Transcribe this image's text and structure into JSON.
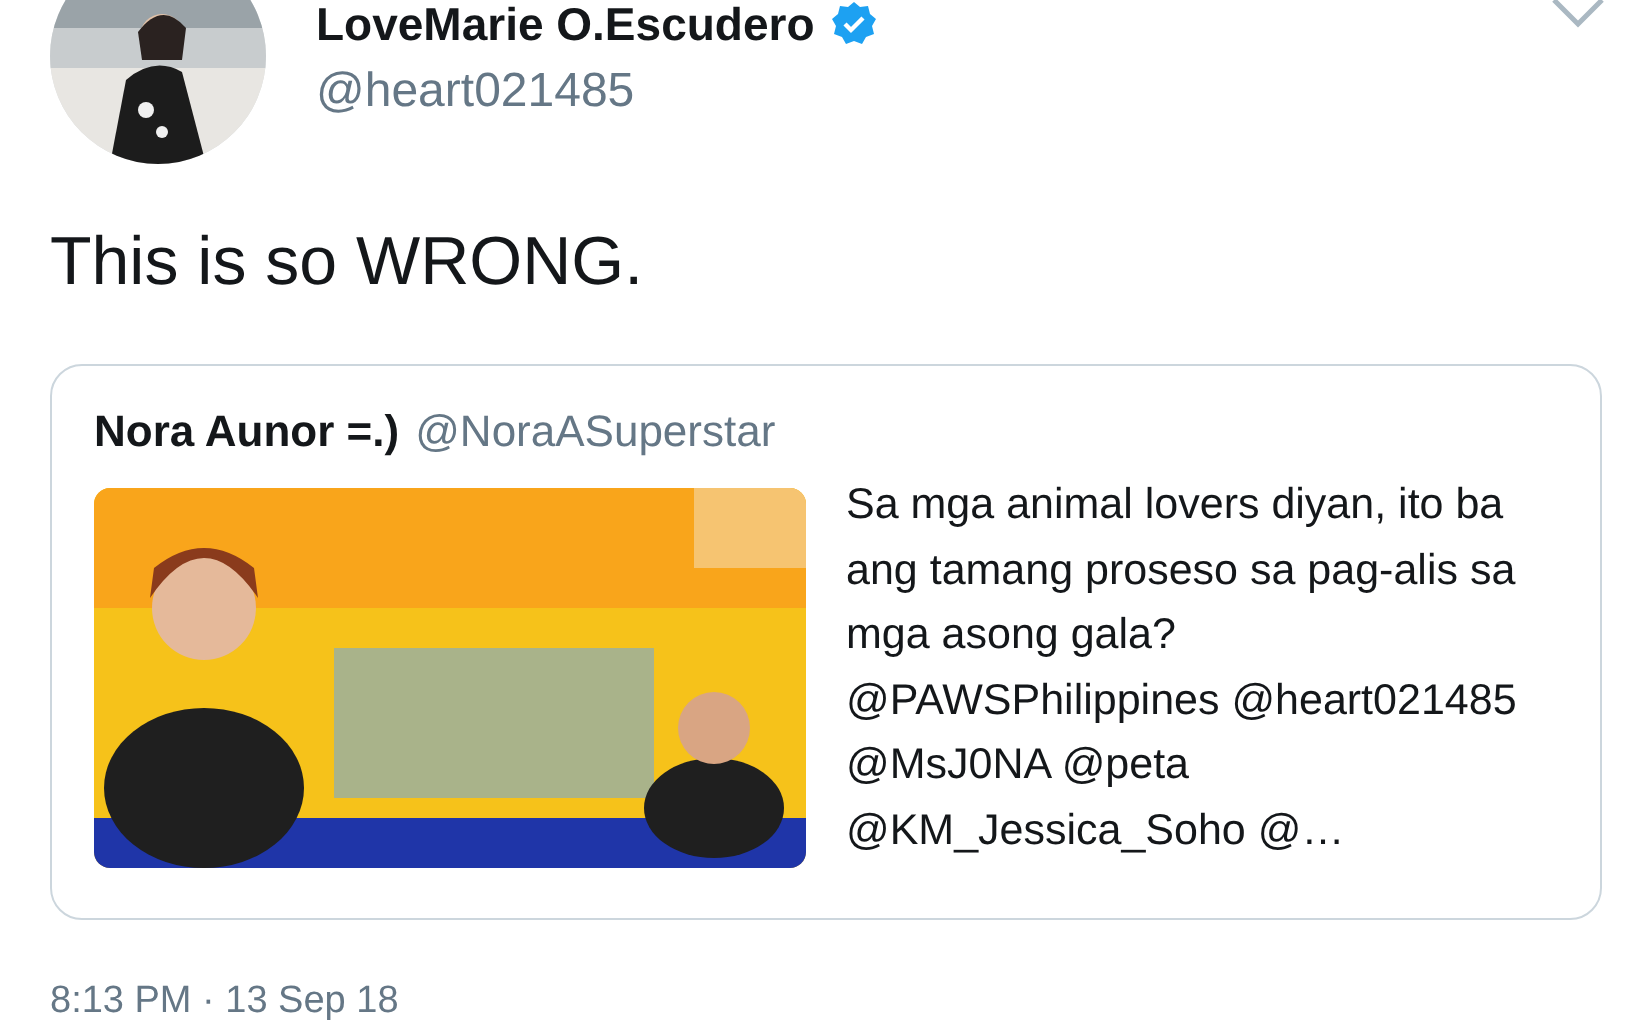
{
  "author": {
    "name": "LoveMarie O.Escudero",
    "verified": true,
    "handle": "@heart021485"
  },
  "tweet": {
    "text": "This is so WRONG."
  },
  "quoted_tweet": {
    "name": "Nora Aunor =.)",
    "handle": "@NoraASuperstar",
    "text": "Sa mga animal lovers diyan, ito ba ang tamang proseso sa pag-alis sa mga asong gala? @PAWSPhilippines @heart021485 @MsJ0NA @peta @KM_Jessica_Soho @…"
  },
  "timestamp": "8:13 PM · 13 Sep 18"
}
